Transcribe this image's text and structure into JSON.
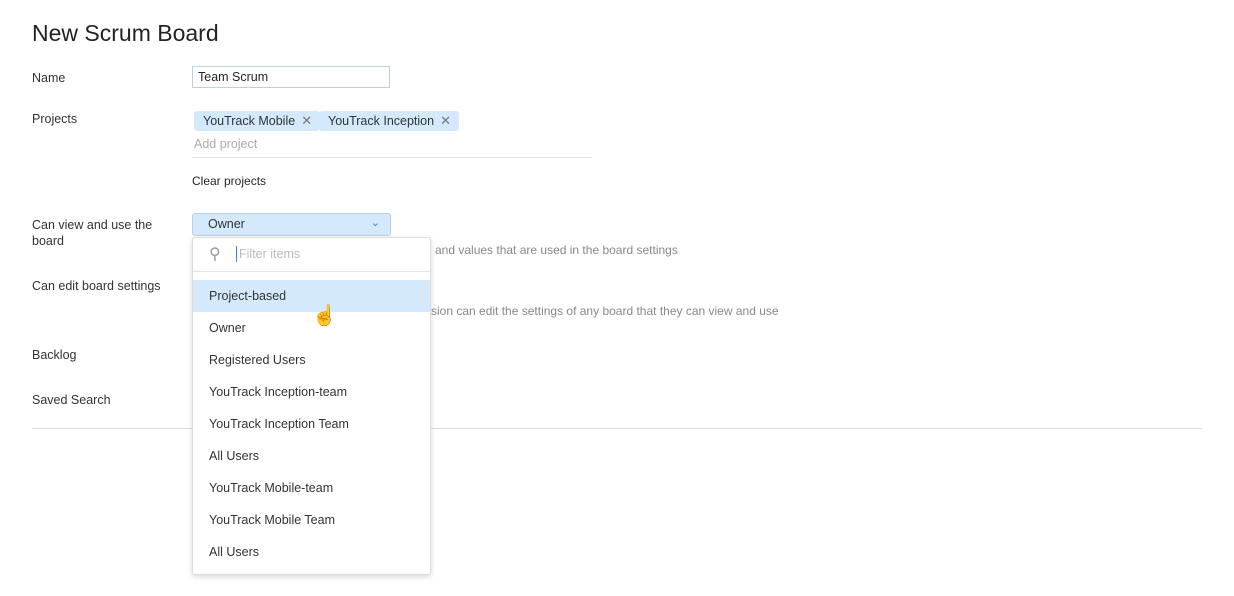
{
  "page_title": "New Scrum Board",
  "fields": {
    "name_label": "Name",
    "name_value": "Team Scrum",
    "projects_label": "Projects",
    "projects": [
      {
        "label": "YouTrack Mobile"
      },
      {
        "label": "YouTrack Inception"
      }
    ],
    "add_project_placeholder": "Add project",
    "clear_projects": "Clear projects",
    "view_label": "Can view and use the board",
    "view_value": "Owner",
    "view_hint": "and values that are used in the board settings",
    "edit_label": "Can edit board settings",
    "edit_hint": "sion can edit the settings of any board that they can view and use",
    "backlog_label": "Backlog",
    "saved_search_label": "Saved Search"
  },
  "dropdown": {
    "filter_placeholder": "Filter items",
    "items": [
      "Project-based",
      "Owner",
      "Registered Users",
      "YouTrack Inception-team",
      "YouTrack Inception Team",
      "All Users",
      "YouTrack Mobile-team",
      "YouTrack Mobile Team",
      "All Users"
    ],
    "highlighted": "Project-based"
  }
}
